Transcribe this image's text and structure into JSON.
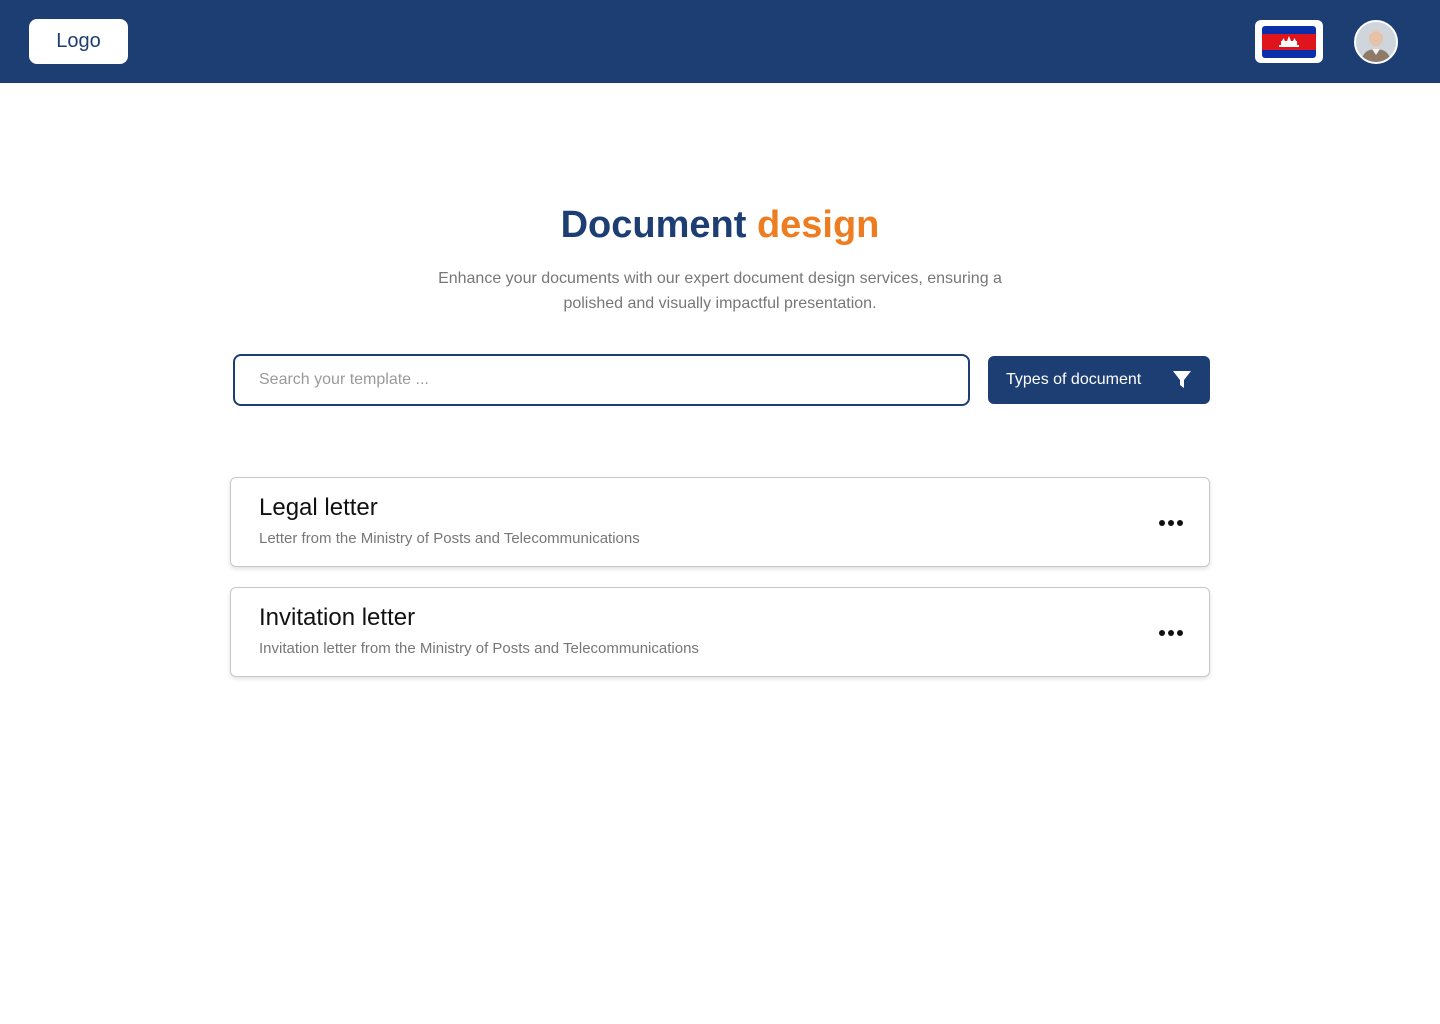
{
  "header": {
    "logo_label": "Logo",
    "language_flag": "cambodia-flag",
    "avatar": "user-avatar",
    "bg_color": "#1d3e73"
  },
  "hero": {
    "title_part1": "Document",
    "title_part2": "design",
    "title_color1": "#1d3e73",
    "title_color2": "#ee7d22",
    "subtitle": "Enhance your documents with our expert document design services, ensuring a polished and visually impactful presentation."
  },
  "search": {
    "placeholder": "Search your template ...",
    "value": ""
  },
  "filter": {
    "label": "Types of document",
    "icon": "filter-icon"
  },
  "documents": [
    {
      "title": "Legal letter",
      "description": "Letter from the Ministry of Posts and Telecommunications"
    },
    {
      "title": "Invitation letter",
      "description": "Invitation letter from the Ministry of Posts and Telecommunications"
    }
  ]
}
